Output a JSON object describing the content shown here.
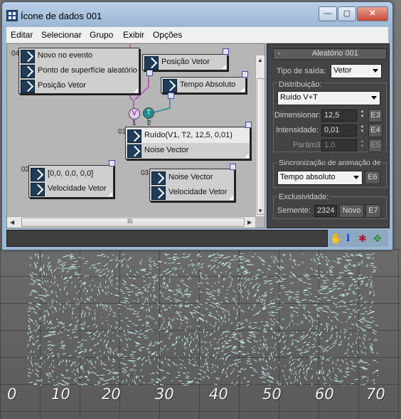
{
  "window": {
    "title": "Ícone de dados 001",
    "controls": {
      "minimize": "—",
      "maximize": "▢",
      "close": "✕"
    }
  },
  "menu": [
    "Editar",
    "Selecionar",
    "Grupo",
    "Exibir",
    "Opções"
  ],
  "canvas": {
    "nodes": {
      "n04": {
        "number": "04",
        "rows": [
          "Novo no evento",
          "Ponto de superfície aleatório",
          "Posição Vetor"
        ]
      },
      "pos_vetor": {
        "rows": [
          "Posição Vetor"
        ]
      },
      "tempo_abs": {
        "rows": [
          "Tempo Absoluto"
        ]
      },
      "n01": {
        "number": "01",
        "rows": [
          "Ruído(V1, T2, 12,5, 0,01)",
          "Noise Vector"
        ],
        "ports": [
          "1",
          "2"
        ]
      },
      "n02": {
        "number": "02",
        "rows": [
          "[0,0, 0,0, 0,0]",
          "Velocidade Vetor"
        ]
      },
      "n03": {
        "number": "03",
        "rows": [
          "Noise Vector",
          "Velocidade Vetor"
        ]
      }
    },
    "connectors": {
      "v": "V",
      "t": "T"
    },
    "scrollbar_grip": "III"
  },
  "panel": {
    "rollout_title": "Aleatório 001",
    "rollout_toggle": "-",
    "output_type_label": "Tipo de saída:",
    "output_type_value": "Vetor",
    "distribution_group": "Distribuição:",
    "distribution_value": "Ruído V+T",
    "dimension_label": "Dimensionar:",
    "dimension_value": "12,5",
    "dimension_btn": "E3",
    "intensity_label": "Intensidade:",
    "intensity_value": "0,01",
    "intensity_btn": "E4",
    "param3_label": "Parâm3:",
    "param3_value": "1,0",
    "param3_btn": "E5",
    "sync_group": "Sincronização de animação de",
    "sync_value": "Tempo absoluto",
    "sync_btn": "E6",
    "exclusivity_group": "Exclusividade:",
    "seed_label": "Semente:",
    "seed_value": "2324",
    "new_btn": "Novo",
    "seed_btn": "E7"
  },
  "statusbar": {
    "icons": [
      "hand-icon",
      "info-icon",
      "sparkle-icon",
      "move-icon"
    ]
  },
  "viewport": {
    "axis_labels": [
      "0",
      "10",
      "20",
      "30",
      "40",
      "50",
      "60",
      "70"
    ],
    "particle_color": "#c6f2ee"
  }
}
